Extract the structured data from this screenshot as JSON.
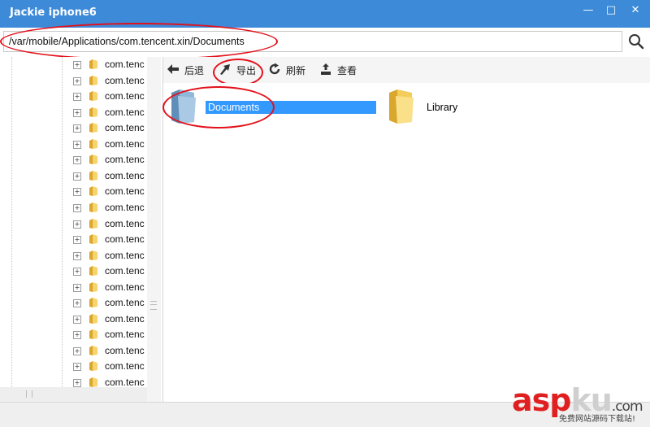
{
  "window": {
    "title": "Jackie iphone6",
    "minimize_glyph": "—",
    "maximize_glyph": "□",
    "close_glyph": "✕",
    "title_bg": "#3c8ad8"
  },
  "address": {
    "path": "/var/mobile/Applications/com.tencent.xin/Documents",
    "search_icon": "search-icon"
  },
  "tree": {
    "items": [
      {
        "label": "com.tenc"
      },
      {
        "label": "com.tenc"
      },
      {
        "label": "com.tenc"
      },
      {
        "label": "com.tenc"
      },
      {
        "label": "com.tenc"
      },
      {
        "label": "com.tenc"
      },
      {
        "label": "com.tenc"
      },
      {
        "label": "com.tenc"
      },
      {
        "label": "com.tenc"
      },
      {
        "label": "com.tenc"
      },
      {
        "label": "com.tenc"
      },
      {
        "label": "com.tenc"
      },
      {
        "label": "com.tenc"
      },
      {
        "label": "com.tenc"
      },
      {
        "label": "com.tenc"
      },
      {
        "label": "com.tenc"
      },
      {
        "label": "com.tenc"
      },
      {
        "label": "com.tenc"
      },
      {
        "label": "com.tenc"
      },
      {
        "label": "com.tenc"
      },
      {
        "label": "com.tenc"
      }
    ]
  },
  "toolbar": {
    "back_label": "后退",
    "export_label": "导出",
    "refresh_label": "刷新",
    "view_label": "查看"
  },
  "content": {
    "items": [
      {
        "label": "Documents",
        "selected": true
      },
      {
        "label": "Library",
        "selected": false
      }
    ]
  },
  "watermark": {
    "main_asp": "asp",
    "main_ku": "ku",
    "main_com": ".com",
    "sub": "免费网站源码下载站!"
  },
  "colors": {
    "accent": "#3c8ad8",
    "selection": "#3399ff",
    "annotation": "#e3101a",
    "watermark": "#e02020"
  }
}
